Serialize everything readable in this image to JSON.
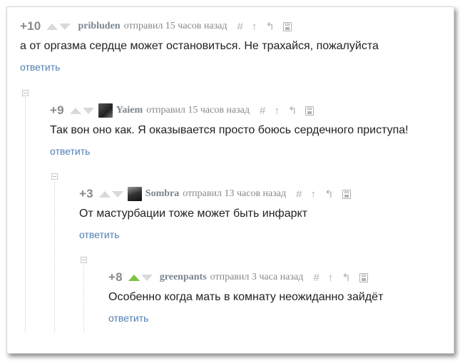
{
  "comments": [
    {
      "rating": "+10",
      "username": "pribluden",
      "meta": "отправил 15 часов назад",
      "text": "а от оргазма сердце может остановиться. Не трахайся, пожалуйста",
      "reply": "ответить",
      "has_avatar": false,
      "upvoted": false
    },
    {
      "rating": "+9",
      "username": "Yaiem",
      "meta": "отправил 15 часов назад",
      "text": "Так вон оно как. Я оказывается просто боюсь сердечного приступа!",
      "reply": "ответить",
      "has_avatar": true,
      "upvoted": false
    },
    {
      "rating": "+3",
      "username": "Sombra",
      "meta": "отправил 13 часов назад",
      "text": "От мастурбации тоже может быть инфаркт",
      "reply": "ответить",
      "has_avatar": true,
      "upvoted": false
    },
    {
      "rating": "+8",
      "username": "greenpants",
      "meta": "отправил 3 часа назад",
      "text": "Особенно когда мать в комнату неожиданно зайдёт",
      "reply": "ответить",
      "has_avatar": false,
      "upvoted": true
    }
  ],
  "tool_icons": {
    "hash": "#",
    "up": "↑",
    "parent": "↰",
    "save": "save-icon"
  },
  "colors": {
    "rating": "#8a8a8a",
    "username": "#7a8590",
    "reply_link": "#4f7fb5",
    "upvote_active": "#7cc243",
    "arrow_inactive": "#d9d9d9"
  }
}
